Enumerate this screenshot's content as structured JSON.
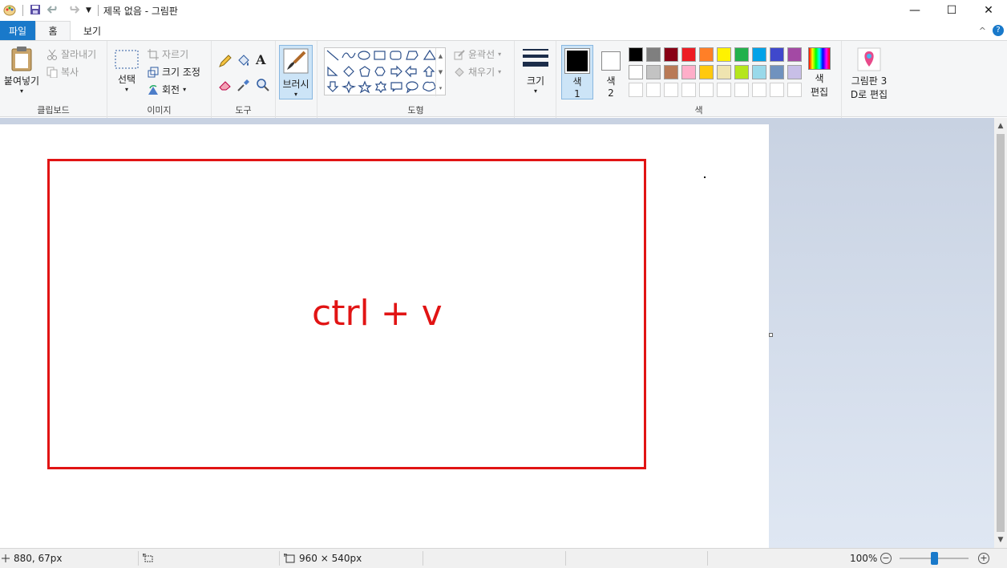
{
  "window": {
    "title": "제목 없음 - 그림판",
    "minimize": "—",
    "maximize": "☐",
    "close": "✕"
  },
  "tabs": {
    "file": "파일",
    "home": "홈",
    "view": "보기",
    "collapse": "^",
    "help": "?"
  },
  "clipboard": {
    "paste": "붙여넣기",
    "cut": "잘라내기",
    "copy": "복사",
    "group": "클립보드"
  },
  "image": {
    "select": "선택",
    "crop": "자르기",
    "resize": "크기 조정",
    "rotate": "회전",
    "group": "이미지"
  },
  "tools": {
    "group": "도구",
    "text_glyph": "A"
  },
  "brushes": {
    "label": "브러시"
  },
  "shapes": {
    "outline": "윤곽선",
    "fill": "채우기",
    "group": "도형"
  },
  "size": {
    "label": "크기"
  },
  "colors": {
    "color1_line1": "색",
    "color1_line2": "1",
    "color2_line1": "색",
    "color2_line2": "2",
    "edit_line1": "색",
    "edit_line2": "편집",
    "group": "색",
    "paint3d_line1": "그림판 3",
    "paint3d_line2": "D로 편집",
    "palette_row1": [
      "#000000",
      "#7f7f7f",
      "#880015",
      "#ed1c24",
      "#ff7f27",
      "#fff200",
      "#22b14c",
      "#00a2e8",
      "#3f48cc",
      "#a349a4"
    ],
    "palette_row2": [
      "#ffffff",
      "#c3c3c3",
      "#b97a57",
      "#ffaec9",
      "#ffc90e",
      "#efe4b0",
      "#b5e61d",
      "#99d9ea",
      "#7092be",
      "#c8bfe7"
    ]
  },
  "canvas": {
    "content_text": "ctrl + v",
    "rect_color": "#e11414"
  },
  "status": {
    "cursor_pos": "880, 67px",
    "image_size": "960 × 540px",
    "zoom": "100%"
  }
}
